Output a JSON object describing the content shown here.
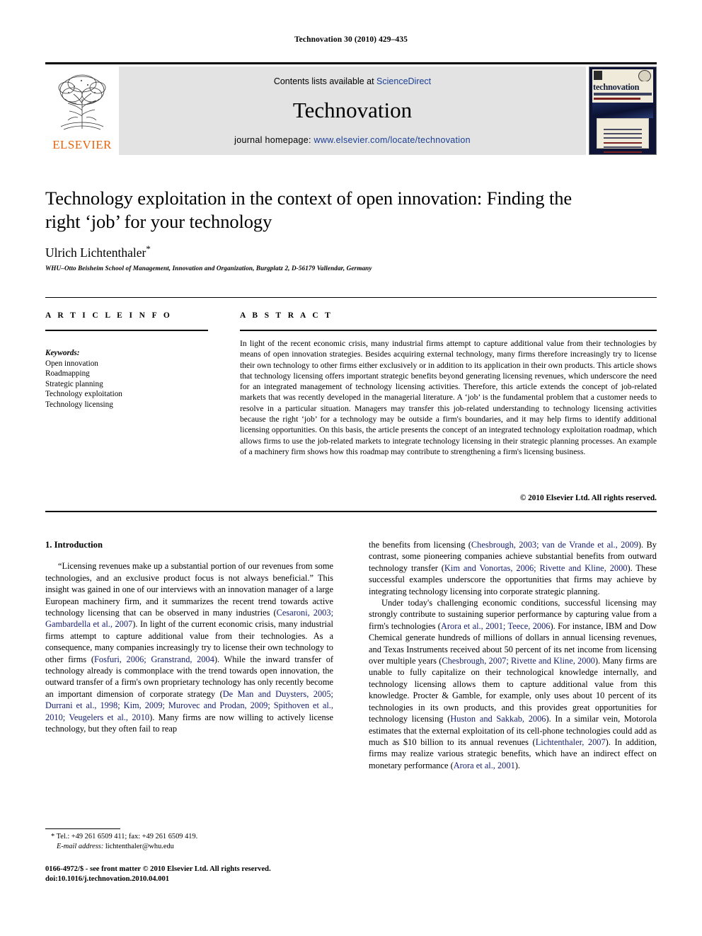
{
  "running_head": "Technovation 30 (2010) 429–435",
  "masthead": {
    "publisher_name": "ELSEVIER",
    "contents_prefix": "Contents lists available at ",
    "contents_link": "ScienceDirect",
    "journal_title": "Technovation",
    "homepage_prefix": "journal homepage: ",
    "homepage_url": "www.elsevier.com/locate/technovation",
    "cover_journal_name": "technovation",
    "link_color": "#1b3f94",
    "banner_bg": "#e3e3e3",
    "elsevier_orange": "#E8620C"
  },
  "article": {
    "title": "Technology exploitation in the context of open innovation: Finding the right ‘job’ for your technology",
    "author": "Ulrich Lichtenthaler",
    "author_marker": "*",
    "affiliation": "WHU–Otto Beisheim School of Management, Innovation and Organization, Burgplatz 2, D-56179 Vallendar, Germany"
  },
  "article_info": {
    "heading": "A R T I C L E   I N F O",
    "keywords_label": "Keywords:",
    "keywords": [
      "Open innovation",
      "Roadmapping",
      "Strategic planning",
      "Technology exploitation",
      "Technology licensing"
    ]
  },
  "abstract": {
    "heading": "A B S T R A C T",
    "text": "In light of the recent economic crisis, many industrial firms attempt to capture additional value from their technologies by means of open innovation strategies. Besides acquiring external technology, many firms therefore increasingly try to license their own technology to other firms either exclusively or in addition to its application in their own products. This article shows that technology licensing offers important strategic benefits beyond generating licensing revenues, which underscore the need for an integrated management of technology licensing activities. Therefore, this article extends the concept of job-related markets that was recently developed in the managerial literature. A ‘job’ is the fundamental problem that a customer needs to resolve in a particular situation. Managers may transfer this job-related understanding to technology licensing activities because the right ‘job’ for a technology may be outside a firm's boundaries, and it may help firms to identify additional licensing opportunities. On this basis, the article presents the concept of an integrated technology exploitation roadmap, which allows firms to use the job-related markets to integrate technology licensing in their strategic planning processes. An example of a machinery firm shows how this roadmap may contribute to strengthening a firm's licensing business.",
    "copyright": "© 2010 Elsevier Ltd. All rights reserved."
  },
  "body": {
    "section_heading": "1.  Introduction",
    "left_paragraphs": [
      {
        "segments": [
          {
            "t": "“Licensing revenues make up a substantial portion of our revenues from some technologies, and an exclusive product focus is not always beneficial.” This insight was gained in one of our interviews with an innovation manager of a large European machinery firm, and it summarizes the recent trend towards active technology licensing that can be observed in many industries (",
            "cite": false
          },
          {
            "t": "Cesaroni, 2003; Gambardella et al., 2007",
            "cite": true
          },
          {
            "t": "). In light of the current economic crisis, many industrial firms attempt to capture additional value from their technologies. As a consequence, many companies increasingly try to license their own technology to other firms (",
            "cite": false
          },
          {
            "t": "Fosfuri, 2006; Granstrand, 2004",
            "cite": true
          },
          {
            "t": "). While the inward transfer of technology already is commonplace with the trend towards open innovation, the outward transfer of a firm's own proprietary technology has only recently become an important dimension of corporate strategy (",
            "cite": false
          },
          {
            "t": "De Man and Duysters, 2005; Durrani et al., 1998; Kim, 2009; Murovec and Prodan, 2009; Spithoven et al., 2010; Veugelers et al., 2010",
            "cite": true
          },
          {
            "t": "). Many firms are now willing to actively license technology, but they often fail to reap",
            "cite": false
          }
        ]
      }
    ],
    "right_paragraphs": [
      {
        "segments": [
          {
            "t": "the benefits from licensing (",
            "cite": false
          },
          {
            "t": "Chesbrough, 2003; van de Vrande et al., 2009",
            "cite": true
          },
          {
            "t": "). By contrast, some pioneering companies achieve substantial benefits from outward technology transfer (",
            "cite": false
          },
          {
            "t": "Kim and Vonortas, 2006; Rivette and Kline, 2000",
            "cite": true
          },
          {
            "t": "). These successful examples underscore the opportunities that firms may achieve by integrating technology licensing into corporate strategic planning.",
            "cite": false
          }
        ],
        "no_indent": true
      },
      {
        "segments": [
          {
            "t": "Under today's challenging economic conditions, successful licensing may strongly contribute to sustaining superior performance by capturing value from a firm's technologies (",
            "cite": false
          },
          {
            "t": "Arora et al., 2001; Teece, 2006",
            "cite": true
          },
          {
            "t": "). For instance, IBM and Dow Chemical generate hundreds of millions of dollars in annual licensing revenues, and Texas Instruments received about 50 percent of its net income from licensing over multiple years (",
            "cite": false
          },
          {
            "t": "Chesbrough, 2007; Rivette and Kline, 2000",
            "cite": true
          },
          {
            "t": "). Many firms are unable to fully capitalize on their technological knowledge internally, and technology licensing allows them to capture additional value from this knowledge. Procter & Gamble, for example, only uses about 10 percent of its technologies in its own products, and this provides great opportunities for technology licensing (",
            "cite": false
          },
          {
            "t": "Huston and Sakkab, 2006",
            "cite": true
          },
          {
            "t": "). In a similar vein, Motorola estimates that the external exploitation of its cell-phone technologies could add as much as $10 billion to its annual revenues (",
            "cite": false
          },
          {
            "t": "Lichtenthaler, 2007",
            "cite": true
          },
          {
            "t": "). In addition, firms may realize various strategic benefits, which have an indirect effect on monetary performance (",
            "cite": false
          },
          {
            "t": "Arora et al., 2001",
            "cite": true
          },
          {
            "t": ").",
            "cite": false
          }
        ]
      }
    ],
    "citation_color": "#16206e"
  },
  "footnotes": {
    "contact_marker": "*",
    "contact": "Tel.: +49 261 6509 411; fax: +49 261 6509 419.",
    "email_label": "E-mail address:",
    "email": "lichtenthaler@whu.edu",
    "front_matter": "0166-4972/$ - see front matter © 2010 Elsevier Ltd. All rights reserved.",
    "doi": "doi:10.1016/j.technovation.2010.04.001"
  }
}
